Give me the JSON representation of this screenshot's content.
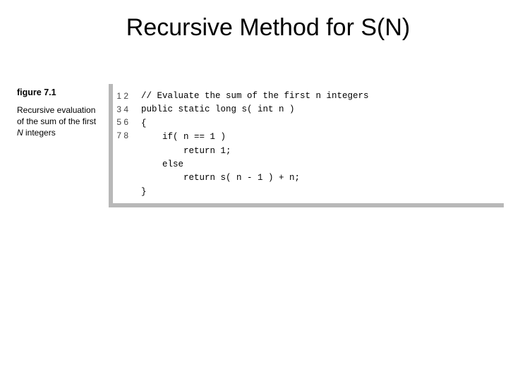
{
  "slide": {
    "title": "Recursive Method for S(N)"
  },
  "figure": {
    "label": "figure 7.1",
    "caption_html": "Recursive evaluation of the sum of the first <em>N</em> integers"
  },
  "code": {
    "line_count": 8,
    "lines": [
      "// Evaluate the sum of the first n integers",
      "public static long s( int n )",
      "{",
      "    if( n == 1 )",
      "        return 1;",
      "    else",
      "        return s( n - 1 ) + n;",
      "}"
    ]
  }
}
